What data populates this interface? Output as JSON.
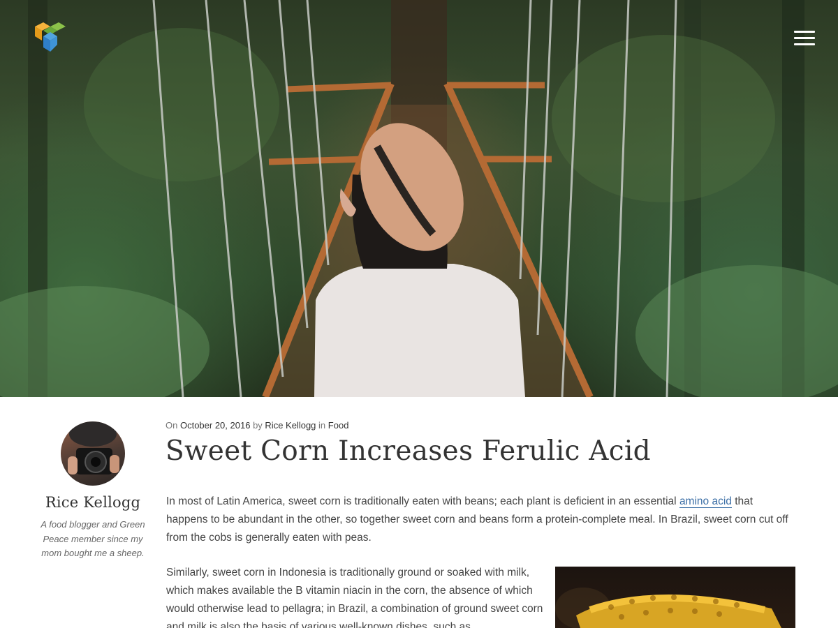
{
  "header": {
    "logo_icon": "cube-logo-icon",
    "menu_icon": "hamburger-menu-icon",
    "hero_image_icon": "forest-bridge-photo"
  },
  "author": {
    "name": "Rice Kellogg",
    "bio": "A food blogger and Green Peace member since my mom bought me a sheep.",
    "avatar_icon": "author-avatar-photo"
  },
  "post": {
    "meta": {
      "on_label": "On",
      "date": "October 20, 2016",
      "by_label": "by",
      "author": "Rice Kellogg",
      "in_label": "in",
      "category": "Food"
    },
    "title": "Sweet Corn Increases Ferulic Acid",
    "para1": {
      "before": "In most of Latin America, sweet corn is traditionally eaten with beans; each plant is deficient in an essential ",
      "link": "amino acid",
      "after": " that happens to be abundant in the other, so together sweet corn and beans form a protein-complete meal. In Brazil, sweet corn cut off from the cobs is generally eaten with peas."
    },
    "para2": "Similarly, sweet corn in Indonesia is traditionally ground or soaked with milk, which makes available the B vitamin niacin in the corn, the absence of which would otherwise lead to pellagra; in Brazil, a combination of ground sweet corn and milk is also the basis of various well-known dishes, such as",
    "inline_image_icon": "corn-photo"
  },
  "colors": {
    "link": "#3c6fa6",
    "text": "#444444",
    "heading": "#333333"
  }
}
